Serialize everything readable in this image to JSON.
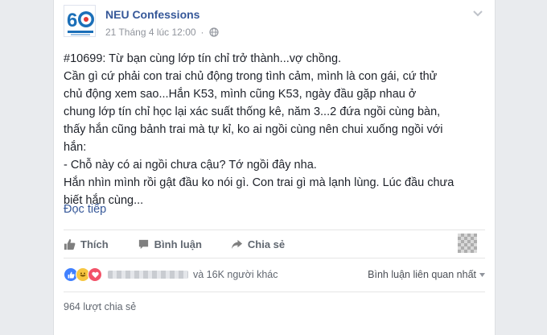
{
  "post": {
    "page_name": "NEU Confessions",
    "timestamp": "21 Tháng 4 lúc 12:00",
    "separator": "·",
    "text_lines": [
      "#10699: Từ bạn cùng lớp tín chỉ trở thành...vợ chồng.",
      "Cần gì cứ phải con trai chủ động trong tình cảm, mình là con gái, cứ thử",
      "chủ động xem sao...Hắn K53, mình cũng K53, ngày đầu gặp nhau ở",
      "chung lớp tín chỉ học lại xác suất thống kê, năm 3...2 đứa ngồi cùng bàn,",
      "thấy hắn cũng bảnh trai mà tự kỉ, ko ai ngồi cùng nên chui xuống ngồi với",
      "hắn:",
      "- Chỗ này có ai ngồi chưa cậu? Tớ ngồi đây nha.",
      "Hắn nhìn mình rồi gật đầu ko nói gì. Con trai gì mà lạnh lùng. Lúc đầu chưa",
      "biết hắn cùng..."
    ],
    "read_more": "Đọc tiếp"
  },
  "actions": {
    "like": "Thích",
    "comment": "Bình luận",
    "share": "Chia sẻ"
  },
  "reactions": {
    "others": "và 16K người khác",
    "comment_filter": "Bình luận liên quan nhất",
    "shares": "964 lượt chia sẻ"
  },
  "colors": {
    "link": "#365899",
    "muted": "#90949c",
    "like_blue": "#4080ff",
    "haha_yellow": "#f7c640",
    "love_red": "#f25268"
  },
  "icons": {
    "avatar": "neu-60-logo",
    "audience": "globe-icon",
    "menu": "chevron-down-icon",
    "like": "thumbs-up-icon",
    "comment": "comment-icon",
    "share": "share-arrow-icon"
  }
}
